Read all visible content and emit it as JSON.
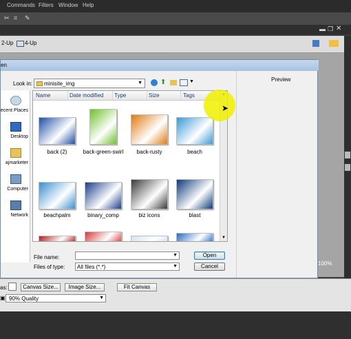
{
  "menubar": {
    "items": [
      "Commands",
      "Filters",
      "Window",
      "Help"
    ]
  },
  "viewbar": {
    "two_up": "2-Up",
    "four_up": "4-Up"
  },
  "zoom": {
    "value": "100%"
  },
  "dialog": {
    "title": "en",
    "look_in_label": "Look in:",
    "look_in_value": "minisite_img",
    "columns": [
      "Name",
      "Date modified",
      "Type",
      "Size",
      "Tags"
    ],
    "places": [
      {
        "label": "ecent Places",
        "icon": "recent-places-icon"
      },
      {
        "label": "Desktop",
        "icon": "desktop-icon"
      },
      {
        "label": "ajmarketer",
        "icon": "user-folder-icon"
      },
      {
        "label": "Computer",
        "icon": "computer-icon"
      },
      {
        "label": "Network",
        "icon": "network-icon"
      }
    ],
    "files": [
      {
        "name": "back (2)",
        "color": "#1f4fa8"
      },
      {
        "name": "back-green-swirl",
        "color": "#6cc22a"
      },
      {
        "name": "back-rusty",
        "color": "#e07a12"
      },
      {
        "name": "beach",
        "color": "#3a9ad6"
      },
      {
        "name": "beachpalm",
        "color": "#3a8fcf"
      },
      {
        "name": "binary_comp",
        "color": "#1c3f8a"
      },
      {
        "name": "biz icons",
        "color": "#3a3a3a"
      },
      {
        "name": "blast",
        "color": "#0d3a7a"
      }
    ],
    "partial_row_colors": [
      "#b01c1c",
      "#d63a3a",
      "#d0e4f4",
      "#2a6cc0"
    ],
    "file_name_label": "File name:",
    "file_name_value": "",
    "files_of_type_label": "Files of type:",
    "files_of_type_value": "All files (*.*)",
    "open_label": "Open",
    "cancel_label": "Cancel",
    "preview_label": "Preview"
  },
  "properties": {
    "canvas_label": "as:",
    "canvas_size": "Canvas Size...",
    "image_size": "Image Size...",
    "fit_canvas": "Fit Canvas",
    "quality": "90% Quality"
  }
}
